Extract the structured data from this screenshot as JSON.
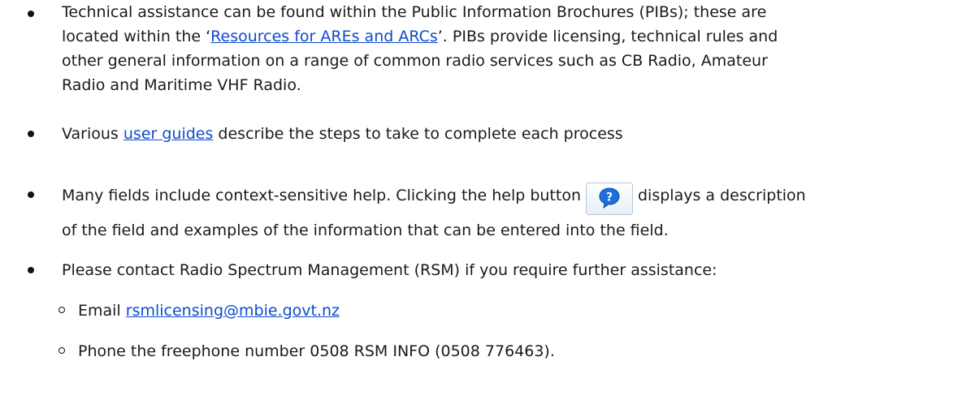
{
  "bullets": [
    {
      "lines": [
        "Technical assistance can be found within the Public Information Brochures (PIBs); these are",
        "located within the ‘",
        "Resources for AREs and ARCs",
        "’. PIBs provide licensing, technical rules and",
        "other general information on a range of common radio services such as CB Radio, Amateur",
        "Radio and Maritime VHF Radio."
      ]
    },
    {
      "pre": "Various ",
      "link": "user guides",
      "post": " describe the steps to take to complete each process"
    },
    {
      "pre": "Many fields include context-sensitive help. Clicking the help button",
      "post": "displays a description",
      "line2": "of the field and examples of the information that can be entered into the field."
    },
    {
      "text": "Please contact Radio Spectrum Management (RSM) if you require further assistance:"
    }
  ],
  "sub_bullets": [
    {
      "pre": "Email ",
      "link": "rsmlicensing@mbie.govt.nz"
    },
    {
      "text": "Phone the freephone number 0508 RSM INFO (0508 776463)."
    }
  ],
  "icons": {
    "help": "help-question-icon"
  },
  "colors": {
    "link": "#0b4bd1",
    "help_icon": "#1e6fd6"
  }
}
